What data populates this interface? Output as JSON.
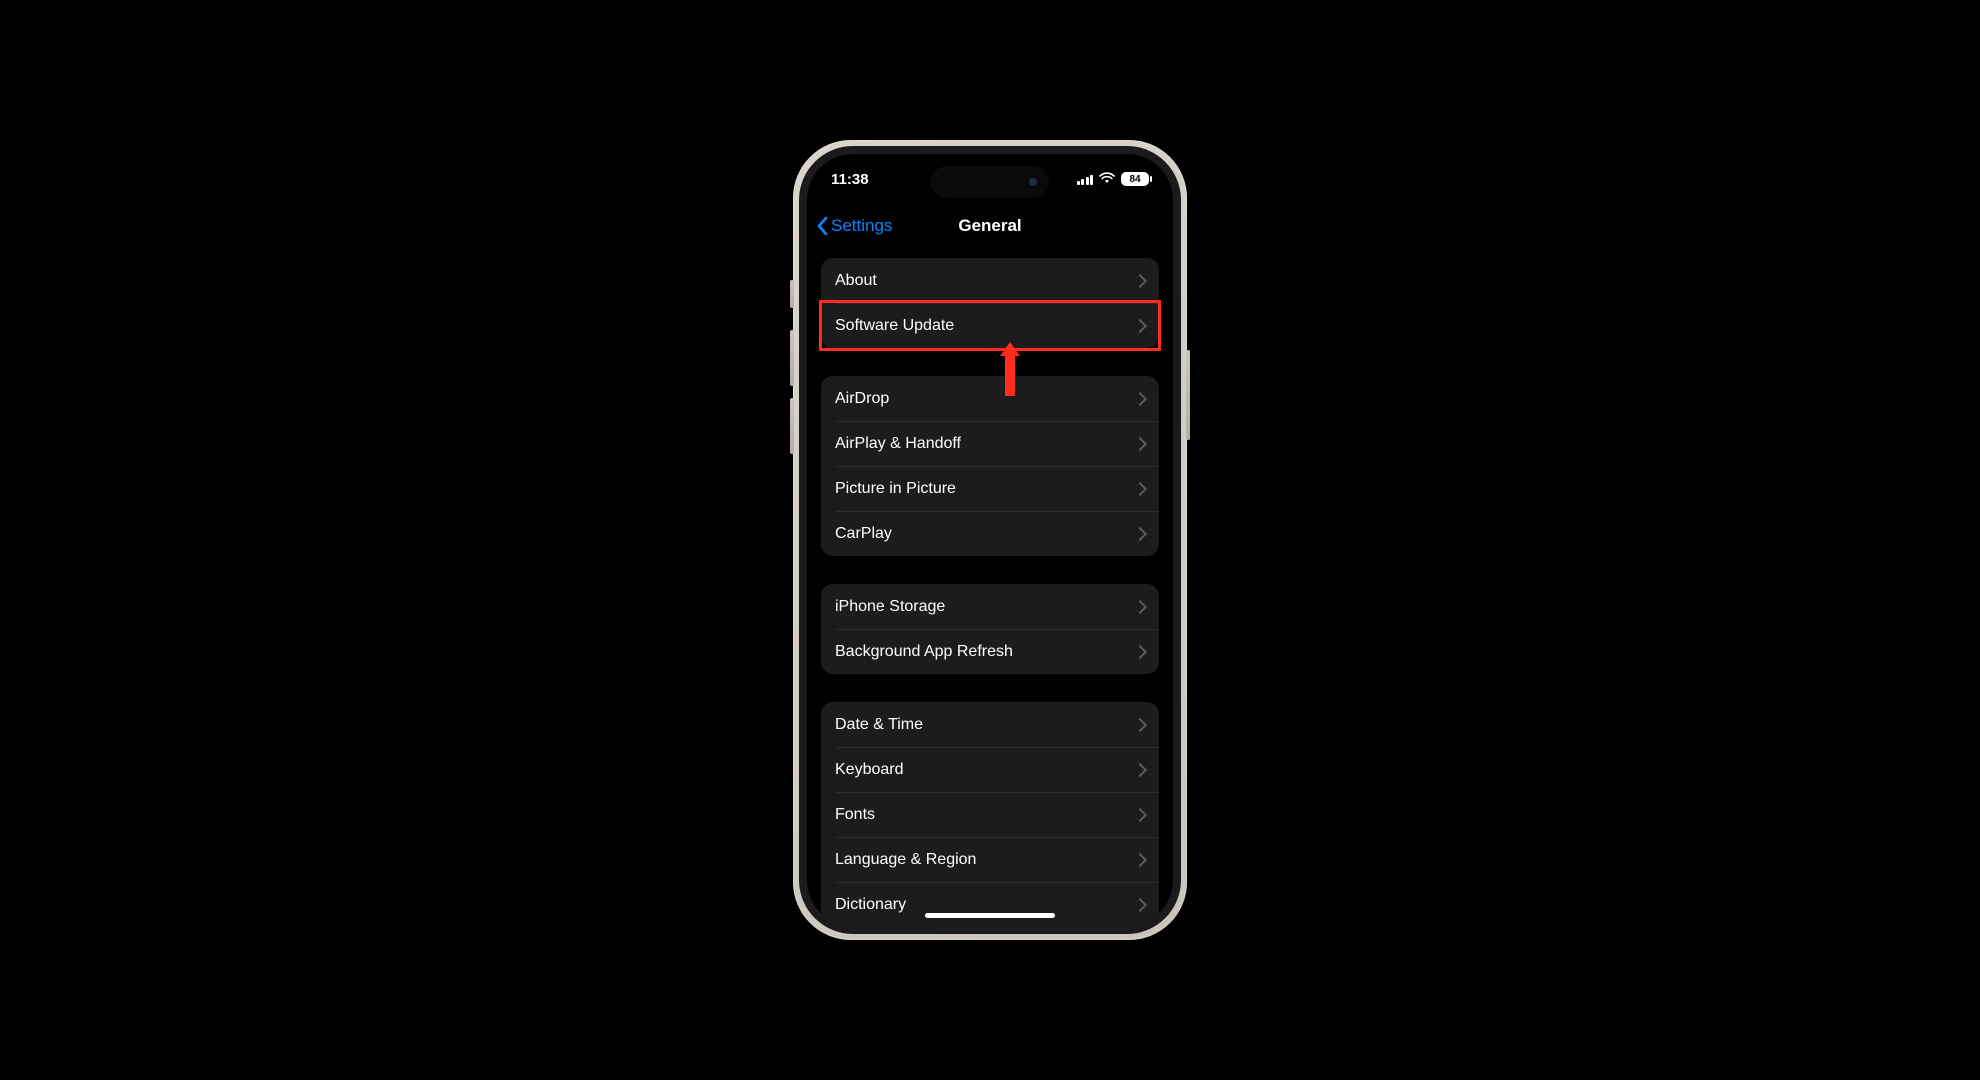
{
  "colors": {
    "accent": "#0a84ff",
    "highlight": "#ff2b1f"
  },
  "status": {
    "time": "11:38",
    "battery": "84"
  },
  "nav": {
    "back_label": "Settings",
    "title": "General"
  },
  "groups": [
    {
      "rows": [
        {
          "id": "about",
          "label": "About"
        },
        {
          "id": "software-update",
          "label": "Software Update",
          "highlighted": true
        }
      ]
    },
    {
      "rows": [
        {
          "id": "airdrop",
          "label": "AirDrop"
        },
        {
          "id": "airplay-handoff",
          "label": "AirPlay & Handoff"
        },
        {
          "id": "picture-in-picture",
          "label": "Picture in Picture"
        },
        {
          "id": "carplay",
          "label": "CarPlay"
        }
      ]
    },
    {
      "rows": [
        {
          "id": "iphone-storage",
          "label": "iPhone Storage"
        },
        {
          "id": "background-app-refresh",
          "label": "Background App Refresh"
        }
      ]
    },
    {
      "rows": [
        {
          "id": "date-time",
          "label": "Date & Time"
        },
        {
          "id": "keyboard",
          "label": "Keyboard"
        },
        {
          "id": "fonts",
          "label": "Fonts"
        },
        {
          "id": "language-region",
          "label": "Language & Region"
        },
        {
          "id": "dictionary",
          "label": "Dictionary"
        }
      ]
    }
  ]
}
